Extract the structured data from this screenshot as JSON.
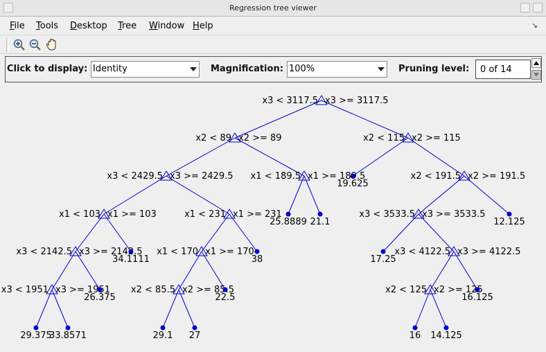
{
  "window": {
    "title": "Regression tree viewer"
  },
  "menu": [
    {
      "first": "F",
      "rest": "ile"
    },
    {
      "first": "T",
      "rest": "ools"
    },
    {
      "first": "D",
      "rest": "esktop"
    },
    {
      "first": "T",
      "rest": "ree"
    },
    {
      "first": "W",
      "rest": "indow"
    },
    {
      "first": "H",
      "rest": "elp"
    }
  ],
  "toolbar": {
    "icons": [
      "zoom-in-icon",
      "zoom-out-icon",
      "pan-icon"
    ]
  },
  "controls": {
    "display_label": "Click to display:",
    "display_value": "Identity",
    "magnification_label": "Magnification:",
    "magnification_value": "100%",
    "pruning_label": "Pruning level:",
    "pruning_value": "0 of 14"
  },
  "tree": {
    "colors": {
      "edge": "#0000cc",
      "node": "#0000cc",
      "text": "#000000"
    },
    "branches": [
      {
        "id": "b1",
        "left": "x3 < 3117.5",
        "right": "x3 >= 3117.5"
      },
      {
        "id": "b2",
        "left": "x2 < 89",
        "right": "x2 >= 89"
      },
      {
        "id": "b3",
        "left": "x2 < 115",
        "right": "x2 >= 115"
      },
      {
        "id": "b4",
        "left": "x3 < 2429.5",
        "right": "x3 >= 2429.5"
      },
      {
        "id": "b5",
        "left": "x1 < 189.5",
        "right": "x1 >= 189.5"
      },
      {
        "id": "b6",
        "left": "x2 < 191.5",
        "right": "x2 >= 191.5"
      },
      {
        "id": "b7",
        "left": "x1 < 103",
        "right": "x1 >= 103"
      },
      {
        "id": "b8",
        "left": "x1 < 231",
        "right": "x1 >= 231"
      },
      {
        "id": "b9",
        "left": "x3 < 3533.5",
        "right": "x3 >= 3533.5"
      },
      {
        "id": "b10",
        "left": "x3 < 2142.5",
        "right": "x3 >= 2142.5"
      },
      {
        "id": "b11",
        "left": "x1 < 170",
        "right": "x1 >= 170"
      },
      {
        "id": "b12",
        "left": "x3 < 4122.5",
        "right": "x3 >= 4122.5"
      },
      {
        "id": "b13",
        "left": "x3 < 1951",
        "right": "x3 >= 1951"
      },
      {
        "id": "b14",
        "left": "x2 < 85.5",
        "right": "x2 >= 85.5"
      },
      {
        "id": "b15",
        "left": "x2 < 125",
        "right": "x2 >= 125"
      }
    ],
    "leaves": [
      {
        "id": "l1",
        "value": "19.625"
      },
      {
        "id": "l2",
        "value": "25.8889"
      },
      {
        "id": "l3",
        "value": "21.1"
      },
      {
        "id": "l4",
        "value": "12.125"
      },
      {
        "id": "l5",
        "value": "34.1111"
      },
      {
        "id": "l6",
        "value": "38"
      },
      {
        "id": "l7",
        "value": "17.25"
      },
      {
        "id": "l8",
        "value": "26.375"
      },
      {
        "id": "l9",
        "value": "22.5"
      },
      {
        "id": "l10",
        "value": "16.125"
      },
      {
        "id": "l11",
        "value": "29.375"
      },
      {
        "id": "l12",
        "value": "33.8571"
      },
      {
        "id": "l13",
        "value": "29.1"
      },
      {
        "id": "l14",
        "value": "27"
      },
      {
        "id": "l15",
        "value": "16"
      },
      {
        "id": "l16",
        "value": "14.125"
      }
    ]
  }
}
